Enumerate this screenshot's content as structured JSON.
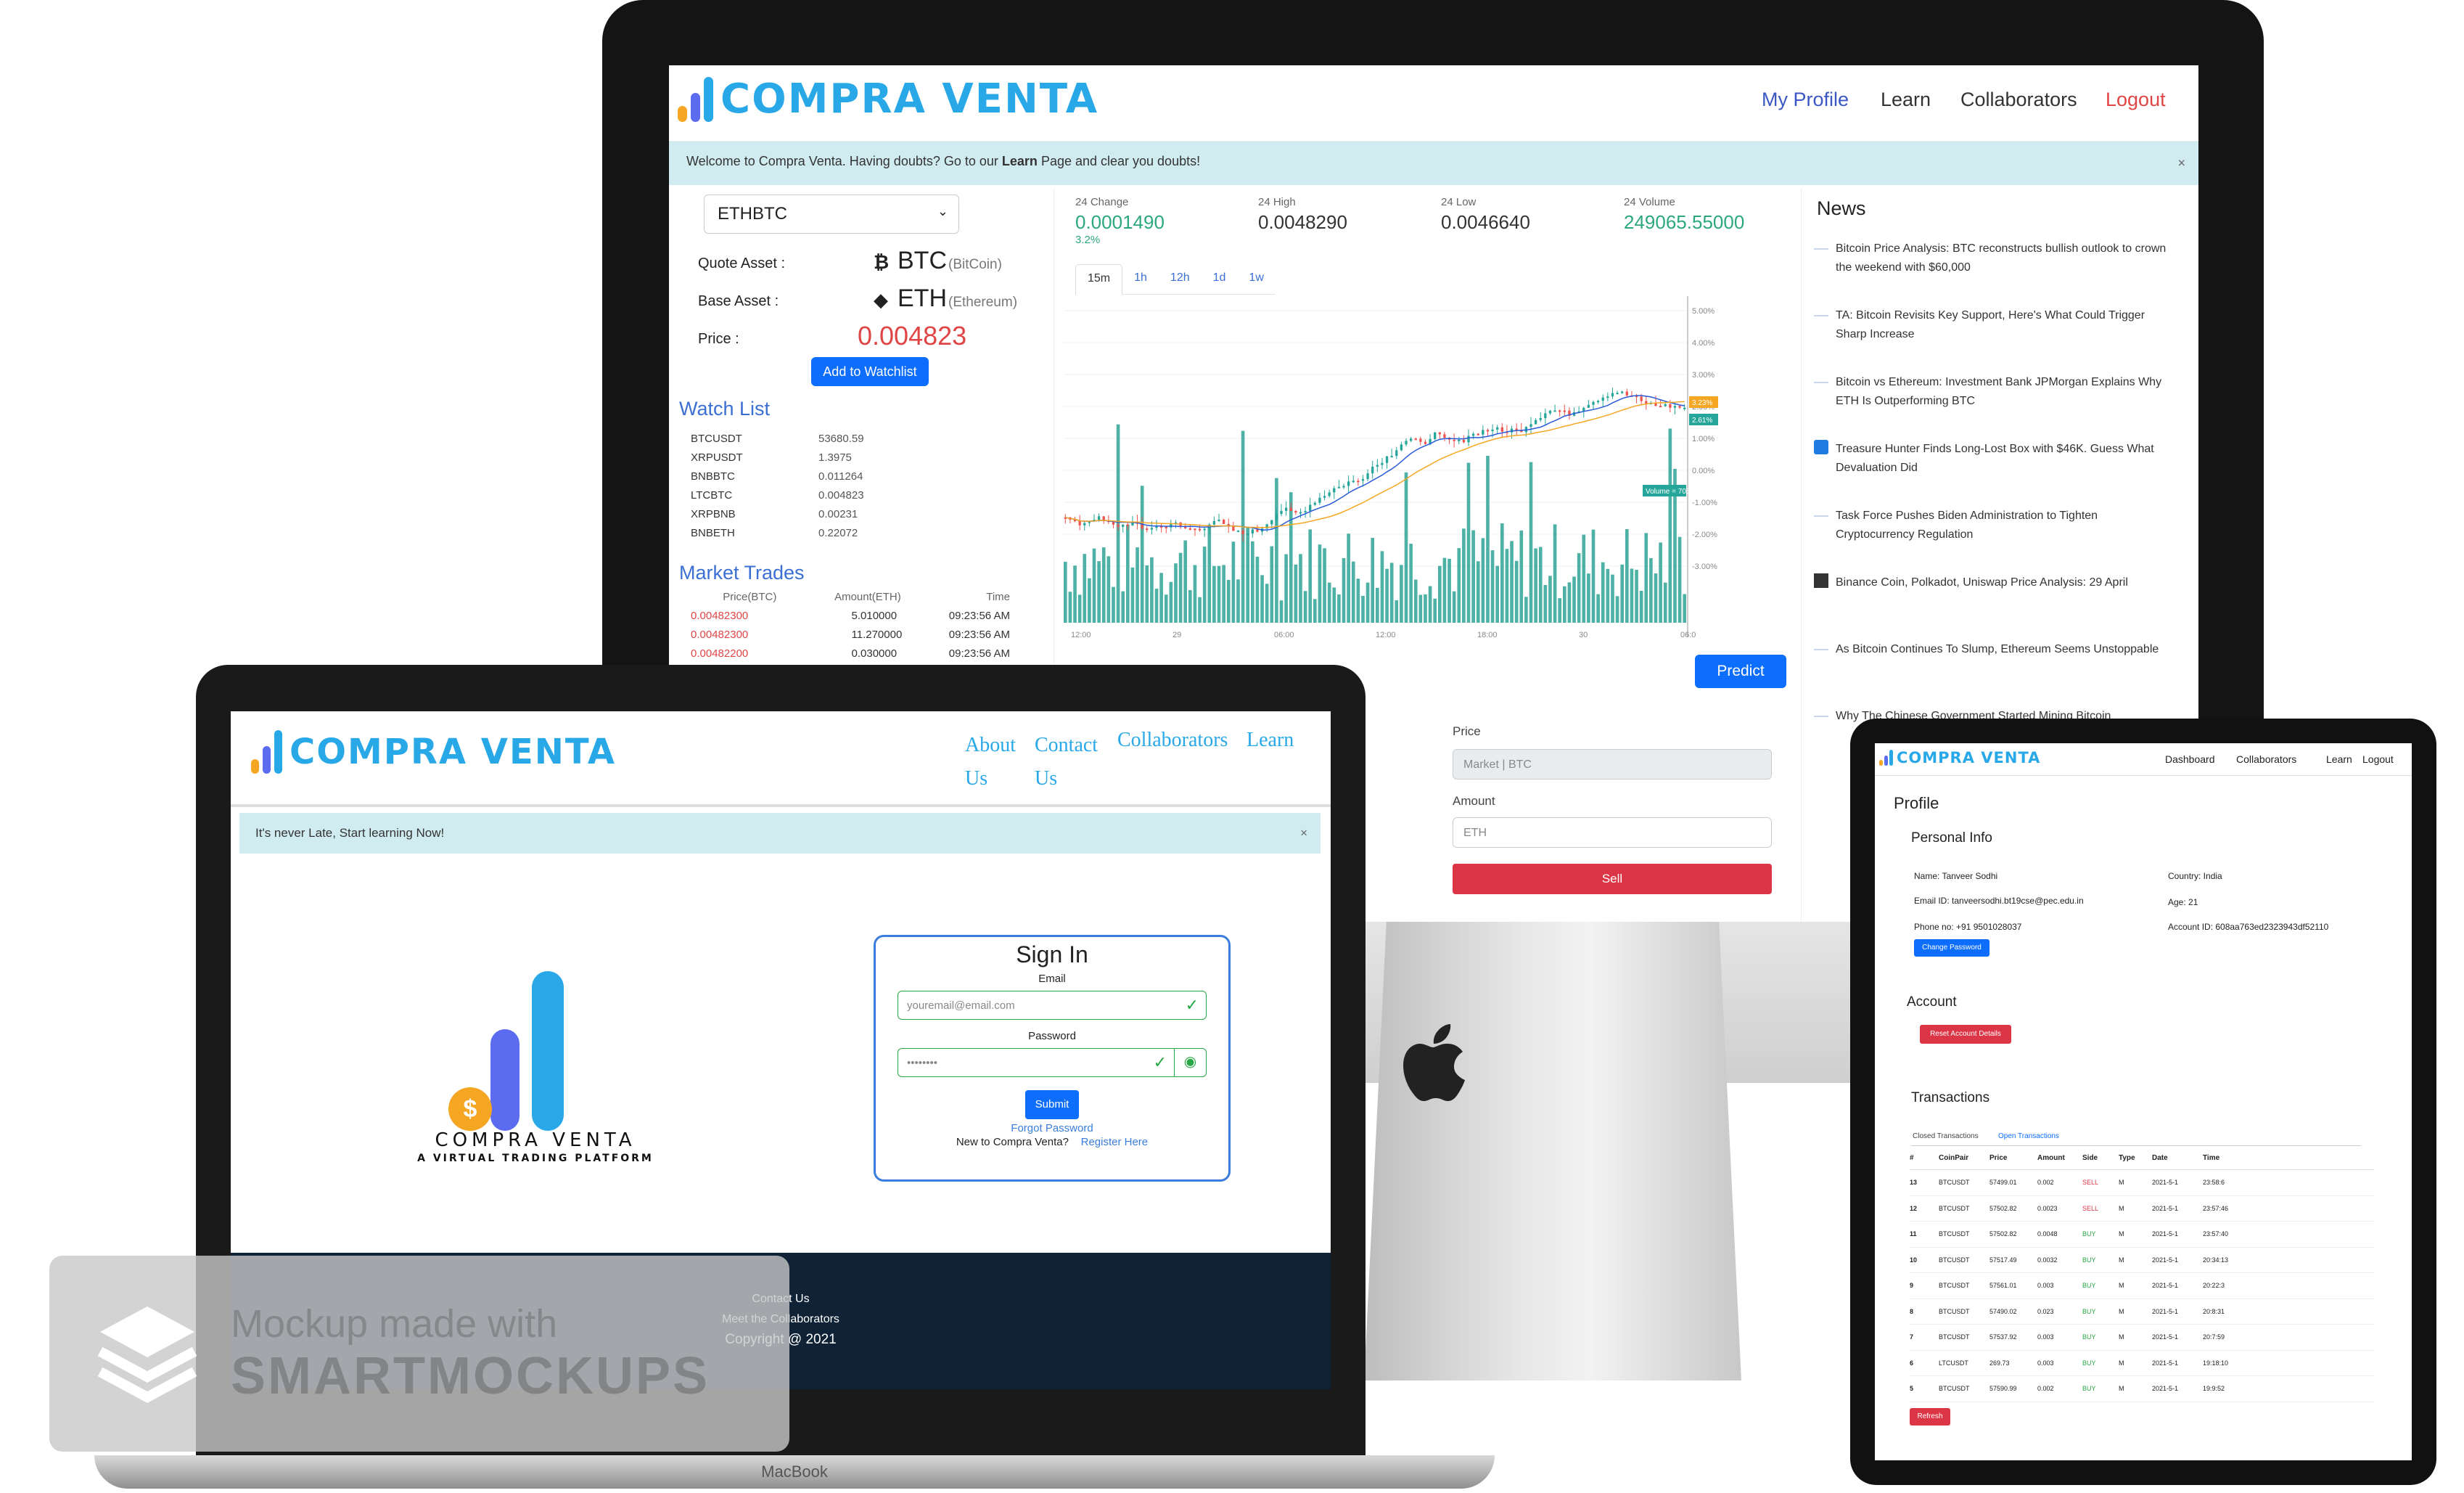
{
  "brand": {
    "name": "COMPRA VENTA",
    "tagline": "A VIRTUAL TRADING PLATFORM",
    "colors": {
      "blue": "#29a8e8",
      "primary": "#0d6efd",
      "green": "#2ca87f",
      "red": "#dc3545"
    }
  },
  "desktop": {
    "nav": {
      "profile": "My Profile",
      "learn": "Learn",
      "collaborators": "Collaborators",
      "logout": "Logout"
    },
    "alert": {
      "pre": "Welcome to Compra Venta. Having doubts? Go to our ",
      "bold": "Learn",
      "post": " Page and clear you doubts!",
      "close": "×"
    },
    "pair": {
      "selected": "ETHBTC"
    },
    "quote": {
      "label": "Quote Asset :",
      "symbol": "BTC",
      "name": "(BitCoin)"
    },
    "base": {
      "label": "Base Asset :",
      "symbol": "ETH",
      "name": "(Ethereum)"
    },
    "price": {
      "label": "Price :",
      "value": "0.004823"
    },
    "watchlist_btn": "Add to Watchlist",
    "watchlist": {
      "title": "Watch List",
      "items": [
        [
          "BTCUSDT",
          "53680.59"
        ],
        [
          "XRPUSDT",
          "1.3975"
        ],
        [
          "BNBBTC",
          "0.011264"
        ],
        [
          "LTCBTC",
          "0.004823"
        ],
        [
          "XRPBNB",
          "0.00231"
        ],
        [
          "BNBETH",
          "0.22072"
        ]
      ]
    },
    "trades": {
      "title": "Market Trades",
      "headers": [
        "Price(BTC)",
        "Amount(ETH)",
        "Time"
      ],
      "rows": [
        [
          "0.00482300",
          "5.010000",
          "09:23:56 AM"
        ],
        [
          "0.00482300",
          "11.270000",
          "09:23:56 AM"
        ],
        [
          "0.00482200",
          "0.030000",
          "09:23:56 AM"
        ]
      ]
    },
    "stats": [
      {
        "label": "24 Change",
        "value": "0.0001490",
        "sub": "3.2%"
      },
      {
        "label": "24 High",
        "value": "0.0048290"
      },
      {
        "label": "24 Low",
        "value": "0.0046640"
      },
      {
        "label": "24 Volume",
        "value": "249065.55000"
      }
    ],
    "intervals": [
      "15m",
      "1h",
      "12h",
      "1d",
      "1w"
    ],
    "chart_axis": {
      "y": [
        "5.00%",
        "4.00%",
        "3.00%",
        "2.00%",
        "1.00%",
        "0.00%",
        "-1.00%",
        "-2.00%",
        "-3.00%"
      ],
      "x": [
        "12:00",
        "29",
        "06:00",
        "12:00",
        "18:00",
        "30",
        "06:0"
      ],
      "tags": [
        "3.23%",
        "2.61%",
        "Volume = 705.45"
      ]
    },
    "predict": "Predict",
    "order": {
      "price_label": "Price",
      "price_placeholder": "Market | BTC",
      "amount_label": "Amount",
      "amount_placeholder": "ETH",
      "sell": "Sell"
    },
    "news": {
      "title": "News",
      "items": [
        "Bitcoin Price Analysis: BTC reconstructs bullish outlook to crown the weekend with $60,000",
        "TA: Bitcoin Revisits Key Support, Here's What Could Trigger Sharp Increase",
        "Bitcoin vs Ethereum: Investment Bank JPMorgan Explains Why ETH Is Outperforming BTC",
        "Treasure Hunter Finds Long-Lost Box with $46K. Guess What Devaluation Did",
        "Task Force Pushes Biden Administration to Tighten Cryptocurrency Regulation",
        "Binance Coin, Polkadot, Uniswap Price Analysis: 29 April",
        "As Bitcoin Continues To Slump, Ethereum Seems Unstoppable",
        "Why The Chinese Government Started Mining Bitcoin"
      ]
    }
  },
  "laptop": {
    "nav": {
      "about": "About",
      "about2": "Us",
      "contact": "Contact",
      "contact2": "Us",
      "collaborators": "Collaborators",
      "learn": "Learn"
    },
    "alert": "It's never Late, Start learning Now!",
    "close": "×",
    "signin": {
      "title": "Sign In",
      "email_label": "Email",
      "email_value": "youremail@email.com",
      "password_label": "Password",
      "password_value": "••••••••",
      "submit": "Submit",
      "forgot": "Forgot Password",
      "new": "New to Compra Venta?",
      "register": "Register Here"
    },
    "footer": {
      "contact": "Contact Us",
      "collaborators": "Meet the Collaborators",
      "copyright": "Copyright @ 2021"
    },
    "brandmark": "MacBook"
  },
  "tablet": {
    "nav": {
      "dashboard": "Dashboard",
      "collaborators": "Collaborators",
      "learn": "Learn",
      "logout": "Logout"
    },
    "profile": {
      "title": "Profile",
      "personal": "Personal Info",
      "name": "Name: Tanveer Sodhi",
      "country": "Country: India",
      "email": "Email ID: tanveersodhi.bt19cse@pec.edu.in",
      "age": "Age: 21",
      "phone": "Phone no: +91 9501028037",
      "account_id": "Account ID: 608aa763ed2323943df52110",
      "change_password": "Change Password"
    },
    "account": {
      "title": "Account",
      "reset": "Reset Account Details"
    },
    "transactions": {
      "title": "Transactions",
      "tabs": [
        "Closed Transactions",
        "Open Transactions"
      ],
      "headers": [
        "#",
        "CoinPair",
        "Price",
        "Amount",
        "Side",
        "Type",
        "Date",
        "Time"
      ],
      "rows": [
        [
          "13",
          "BTCUSDT",
          "57499.01",
          "0.002",
          "SELL",
          "M",
          "2021-5-1",
          "23:58:6"
        ],
        [
          "12",
          "BTCUSDT",
          "57502.82",
          "0.0023",
          "SELL",
          "M",
          "2021-5-1",
          "23:57:46"
        ],
        [
          "11",
          "BTCUSDT",
          "57502.82",
          "0.0048",
          "BUY",
          "M",
          "2021-5-1",
          "23:57:40"
        ],
        [
          "10",
          "BTCUSDT",
          "57517.49",
          "0.0032",
          "BUY",
          "M",
          "2021-5-1",
          "20:34:13"
        ],
        [
          "9",
          "BTCUSDT",
          "57561.01",
          "0.003",
          "BUY",
          "M",
          "2021-5-1",
          "20:22:3"
        ],
        [
          "8",
          "BTCUSDT",
          "57490.02",
          "0.023",
          "BUY",
          "M",
          "2021-5-1",
          "20:8:31"
        ],
        [
          "7",
          "BTCUSDT",
          "57537.92",
          "0.003",
          "BUY",
          "M",
          "2021-5-1",
          "20:7:59"
        ],
        [
          "6",
          "LTCUSDT",
          "269.73",
          "0.003",
          "BUY",
          "M",
          "2021-5-1",
          "19:18:10"
        ],
        [
          "5",
          "BTCUSDT",
          "57590.99",
          "0.002",
          "BUY",
          "M",
          "2021-5-1",
          "19:9:52"
        ]
      ],
      "refresh": "Refresh"
    }
  },
  "watermark": {
    "line1": "Mockup made with",
    "line2": "SMARTMOCKUPS"
  }
}
